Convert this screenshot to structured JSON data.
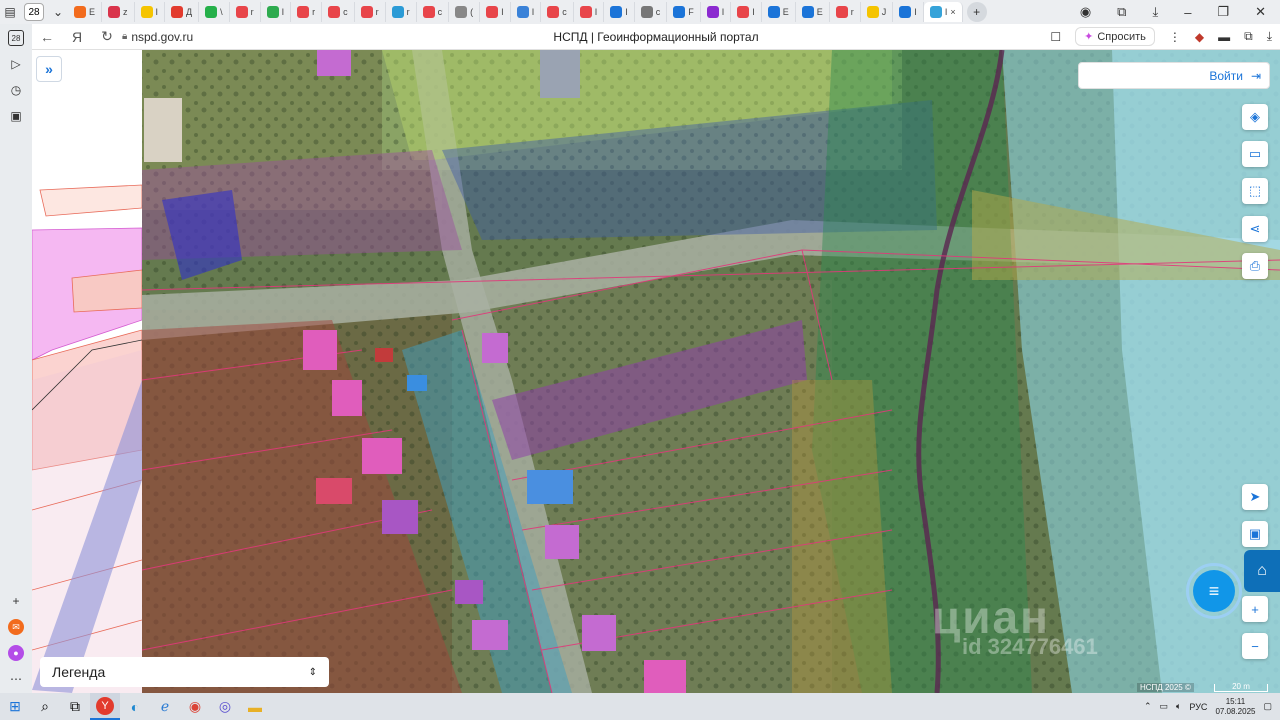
{
  "browser": {
    "tab_count": "28",
    "tabs": [
      {
        "label": "Е",
        "color": "#f26b1d"
      },
      {
        "label": "z",
        "color": "#d9344b"
      },
      {
        "label": "I",
        "color": "#f5c400"
      },
      {
        "label": "Д",
        "color": "#e23b2e"
      },
      {
        "label": "\\",
        "color": "#25b04a"
      },
      {
        "label": "r",
        "color": "#e8454a"
      },
      {
        "label": "I",
        "color": "#2eab4f"
      },
      {
        "label": "r",
        "color": "#e8454a"
      },
      {
        "label": "c",
        "color": "#e8454a"
      },
      {
        "label": "r",
        "color": "#e8454a"
      },
      {
        "label": "r",
        "color": "#2b9bd6"
      },
      {
        "label": "c",
        "color": "#e8454a"
      },
      {
        "label": "(",
        "color": "#888888"
      },
      {
        "label": "I",
        "color": "#e8454a"
      },
      {
        "label": "I",
        "color": "#3a82d8"
      },
      {
        "label": "c",
        "color": "#e8454a"
      },
      {
        "label": "I",
        "color": "#e8454a"
      },
      {
        "label": "I",
        "color": "#1b74d8"
      },
      {
        "label": "c",
        "color": "#777777"
      },
      {
        "label": "F",
        "color": "#1b74d8"
      },
      {
        "label": "I",
        "color": "#8b2ad0"
      },
      {
        "label": "I",
        "color": "#e8454a"
      },
      {
        "label": "E",
        "color": "#1b74d8"
      },
      {
        "label": "E",
        "color": "#1b74d8"
      },
      {
        "label": "r",
        "color": "#e8454a"
      },
      {
        "label": "J",
        "color": "#f5c400"
      },
      {
        "label": "I",
        "color": "#1b74d8"
      }
    ],
    "active_tab_label": "I",
    "url": "nspd.gov.ru",
    "page_title": "НСПД | Геоинформационный портал",
    "ask_label": "Спросить"
  },
  "map": {
    "login_label": "Войти",
    "legend_label": "Легенда",
    "copyright": "НСПД 2025 ©",
    "scale_label": "20 m",
    "watermark": "циан",
    "watermark_id": "id 324776461",
    "tools": [
      "layers-icon",
      "ruler-icon",
      "select-area-icon",
      "share-icon",
      "print-icon"
    ],
    "bottom_tools": [
      "locate-icon",
      "minimap-icon",
      "zoom-in-icon",
      "zoom-out-icon"
    ]
  },
  "taskbar": {
    "language": "РУС",
    "time": "15:11",
    "date": "07.08.2025"
  }
}
